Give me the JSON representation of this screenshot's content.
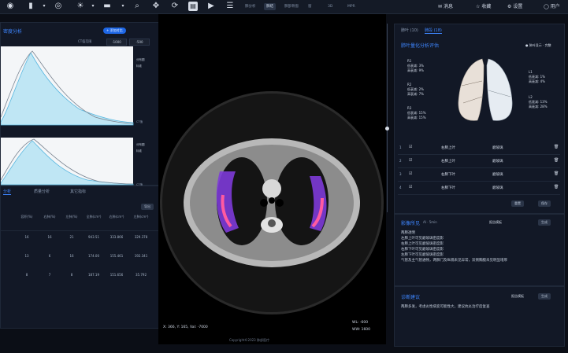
{
  "toolbar": {
    "icons": [
      "target-icon",
      "layout-icon",
      "eye-icon",
      "brightness-icon",
      "window-level-icon",
      "zoom-icon",
      "pan-icon",
      "rotate-icon",
      "report-icon",
      "play-icon",
      "settings-list-icon"
    ],
    "tabs": [
      {
        "label": "肺分析"
      },
      {
        "label": "肺结"
      },
      {
        "label": "肺部骨窗"
      },
      {
        "label": "窗"
      },
      {
        "label": "3D"
      },
      {
        "label": "MPR"
      }
    ],
    "right": {
      "messages": "消息",
      "favorites": "收藏",
      "settings": "设置",
      "user": "用户"
    }
  },
  "left": {
    "title": "密度分析",
    "chip": "+ 添加对比",
    "filter_label": "CT值范围",
    "filter_values": [
      "-1000",
      "-500"
    ],
    "chart_axis_label": "CT值",
    "chart_legend": [
      "分布图",
      "标准"
    ],
    "tabs": [
      "分析",
      "质量分析",
      "其它指标"
    ],
    "export_btn": "导出",
    "table_headers": [
      "容积(%)",
      "右肺(%)",
      "左肺(%)",
      "全肺(cm³)",
      "右肺(cm³)",
      "左肺(cm³)"
    ],
    "table_rows": [
      [
        "16",
        "16",
        "21",
        "943.51",
        "333.866",
        "329.378"
      ],
      [
        "13",
        "6",
        "16",
        "174.00",
        "155.461",
        "192.341"
      ],
      [
        "8",
        "7",
        "8",
        "187.19",
        "151.656",
        "35.792"
      ]
    ]
  },
  "viewer": {
    "bottom_left": "X: 366, Y: 165, Val: -7000",
    "wl": "WL: -600",
    "ww": "WW: 1600",
    "copyright": "Copyright©2023 肺部医疗"
  },
  "right": {
    "tabs": [
      {
        "label": "肺叶 (10)"
      },
      {
        "label": "肺段 (18)"
      }
    ],
    "panel_title": "肺叶量化分析评估",
    "badge": "● 肺叶显示 · 完整",
    "lung_labels": [
      {
        "name": "R1",
        "l1": "低衰减: 3%",
        "l2": "高衰减: 9%"
      },
      {
        "name": "R2",
        "l1": "低衰减: 2%",
        "l2": "高衰减: 7%"
      },
      {
        "name": "R3",
        "l1": "低衰减: 15%",
        "l2": "高衰减: 15%"
      },
      {
        "name": "L1",
        "l1": "低衰减: 1%",
        "l2": "高衰减: 4%"
      },
      {
        "name": "L2",
        "l1": "低衰减: 13%",
        "l2": "高衰减: 28%"
      }
    ],
    "rows": [
      {
        "id": "1",
        "pos": "右肺上叶",
        "type": "磨玻璃"
      },
      {
        "id": "2",
        "pos": "右肺上叶",
        "type": "磨玻璃"
      },
      {
        "id": "3",
        "pos": "右肺下叶",
        "type": "磨玻璃"
      },
      {
        "id": "4",
        "pos": "右肺下叶",
        "type": "磨玻璃"
      }
    ],
    "btn_reset": "重置",
    "btn_save": "保存",
    "findings_title": "影像所见",
    "findings_sub": "AI · 5min",
    "findings_template": "报告模板",
    "findings_btn": "生成",
    "findings_text": [
      "两肺透明",
      "左肺上叶可见磨玻璃密度影",
      "右肺上叶可见磨玻璃密度影",
      "右肺下叶可见磨玻璃密度影",
      "左肺下叶可见磨玻璃密度影",
      "气管及主气管通畅，两肺门及纵隔未见异常，双侧胸膜未见明显增厚"
    ],
    "impression_title": "诊断建议",
    "impression_template": "报告模板",
    "impression_btn": "生成",
    "impression_text": "两肺多发，考虑炎性病变可能性大，建议抗炎治疗后复查"
  }
}
